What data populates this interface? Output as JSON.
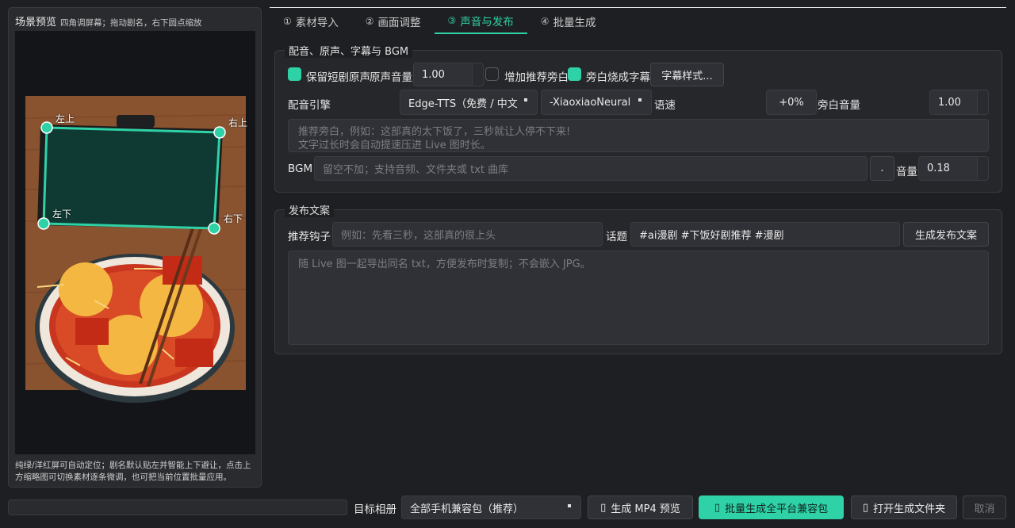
{
  "preview": {
    "title": "场景预览",
    "hint": "四角调屏幕；拖动剧名，右下圆点缩放",
    "corners": {
      "tl": "左上",
      "tr": "右上",
      "bl": "左下",
      "br": "右下"
    },
    "footer": "纯绿/洋红屏可自动定位；剧名默认贴左并智能上下避让，点击上方缩略图可切换素材逐条微调，也可把当前位置批量应用。"
  },
  "tabs": [
    {
      "num": "①",
      "label": "素材导入",
      "active": false
    },
    {
      "num": "②",
      "label": "画面调整",
      "active": false
    },
    {
      "num": "③",
      "label": "声音与发布",
      "active": true
    },
    {
      "num": "④",
      "label": "批量生成",
      "active": false
    }
  ],
  "audio": {
    "group_title": "配音、原声、字幕与 BGM",
    "keep_original_label": "保留短剧原声",
    "keep_original_checked": true,
    "original_volume_label": "原声音量",
    "original_volume": "1.00",
    "add_narration_label": "增加推荐旁白",
    "add_narration_checked": false,
    "burn_subtitle_label": "旁白烧成字幕",
    "burn_subtitle_checked": true,
    "subtitle_style_button": "字幕样式...",
    "engine_label": "配音引擎",
    "engine_value": "Edge-TTS（免费 / 中文",
    "voice_value": "-XiaoxiaoNeural",
    "speed_label": "语速",
    "speed_value": "+0%",
    "narration_volume_label": "旁白音量",
    "narration_volume": "1.00",
    "narration_placeholder_line1": "推荐旁白，例如：这部真的太下饭了，三秒就让人停不下来!",
    "narration_placeholder_line2": "文字过长时会自动提速压进 Live 图时长。",
    "bgm_label": "BGM",
    "bgm_placeholder": "留空不加；支持音频、文件夹或 txt 曲库",
    "bgm_browse": ".",
    "bgm_volume_label": "音量",
    "bgm_volume": "0.18"
  },
  "publish": {
    "group_title": "发布文案",
    "hook_label": "推荐钩子",
    "hook_placeholder": "例如：先看三秒，这部真的很上头",
    "topic_label": "话题",
    "topic_value": "#ai漫剧 #下饭好剧推荐 #漫剧",
    "generate_button": "生成发布文案",
    "copy_placeholder": "随 Live 图一起导出同名 txt，方便发布时复制；不会嵌入 JPG。"
  },
  "bottom": {
    "album_label": "目标相册",
    "album_value": "全部手机兼容包（推荐）",
    "mp4_button": "生成 MP4 预览",
    "batch_button": "批量生成全平台兼容包",
    "open_folder_button": "打开生成文件夹",
    "cancel_button": "取消",
    "icon_glyph": "▯"
  },
  "colors": {
    "accent": "#2fd1a6",
    "background": "#1e1f22",
    "panel": "#26272b"
  }
}
